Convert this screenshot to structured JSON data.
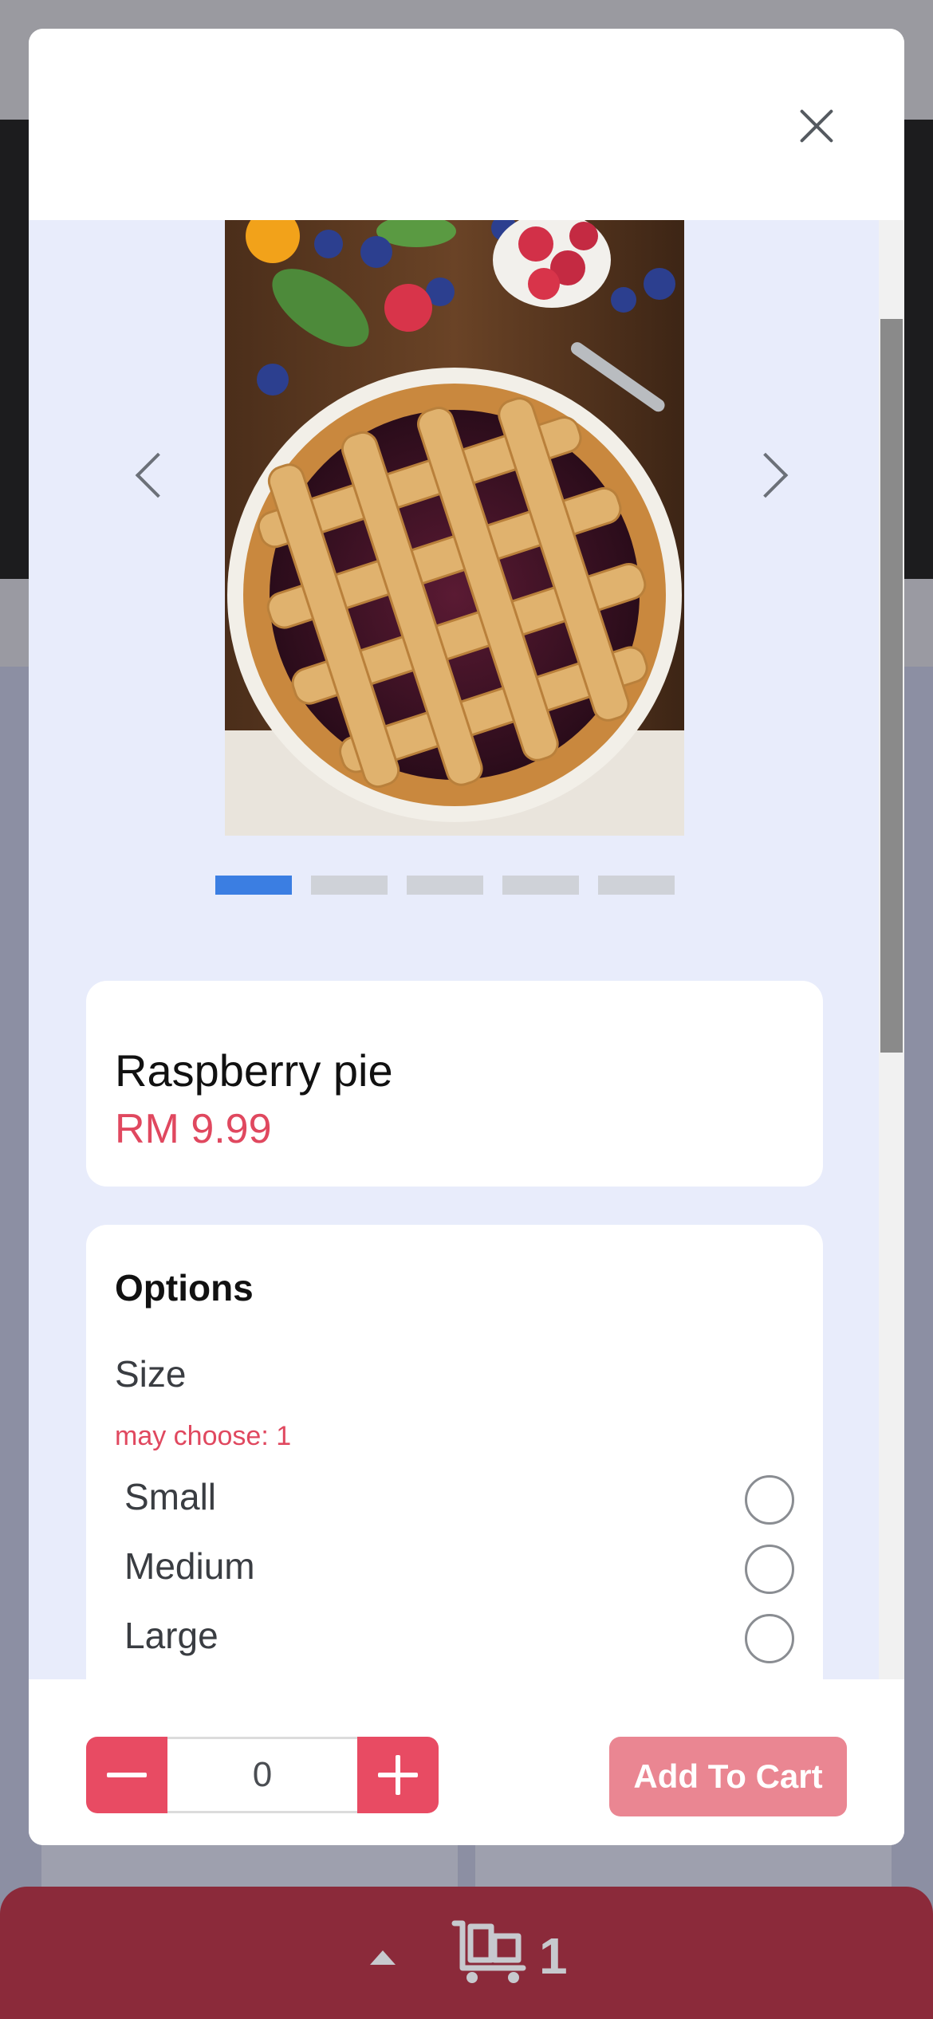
{
  "modal": {
    "close_icon": "close-icon"
  },
  "carousel": {
    "image_alt": "Raspberry pie",
    "total_slides": 5,
    "active_slide": 1,
    "prev_icon": "chevron-left-icon",
    "next_icon": "chevron-right-icon"
  },
  "product": {
    "name": "Raspberry pie",
    "price": "RM 9.99"
  },
  "options": {
    "title": "Options",
    "groups": [
      {
        "label": "Size",
        "hint": "may choose: 1",
        "choices": [
          {
            "label": "Small",
            "selected": false
          },
          {
            "label": "Medium",
            "selected": false
          },
          {
            "label": "Large",
            "selected": false
          }
        ]
      }
    ]
  },
  "footer": {
    "quantity": "0",
    "add_to_cart_label": "Add To Cart"
  },
  "cart_bar": {
    "count": "1",
    "icon": "cart-icon"
  },
  "colors": {
    "accent": "#e84b63",
    "price": "#e0485f",
    "active_dot": "#3b7ee2",
    "cart_bar": "#8b2a3a"
  }
}
